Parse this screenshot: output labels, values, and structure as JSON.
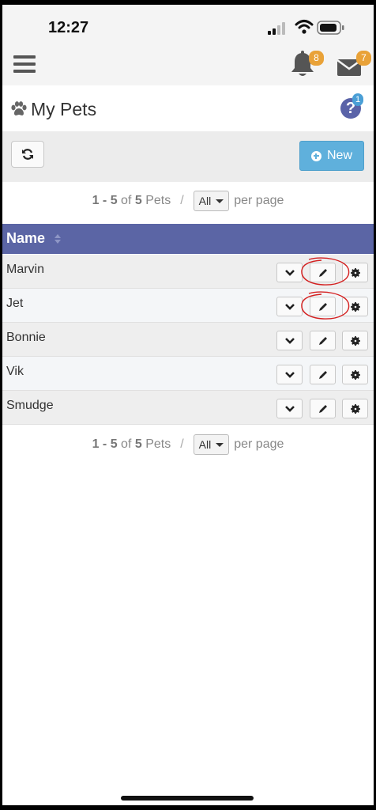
{
  "status_bar": {
    "time": "12:27"
  },
  "nav": {
    "notifications_count": "8",
    "messages_count": "7"
  },
  "title_bar": {
    "title": "My Pets",
    "help_badge": "1",
    "help_symbol": "?"
  },
  "toolbar": {
    "new_label": "New"
  },
  "pagination": {
    "range": "1 - 5",
    "of_text": "of",
    "total": "5",
    "unit": "Pets",
    "separator": "/",
    "per_page_value": "All",
    "per_page_text": "per page"
  },
  "table": {
    "column_name": "Name",
    "rows": [
      {
        "name": "Marvin"
      },
      {
        "name": "Jet"
      },
      {
        "name": "Bonnie"
      },
      {
        "name": "Vik"
      },
      {
        "name": "Smudge"
      }
    ]
  },
  "colors": {
    "header_bg": "#5b65a5",
    "new_button": "#5fb0dc",
    "badge": "#e9a238",
    "annotation": "#d42020"
  },
  "icons": [
    "hamburger-icon",
    "bell-icon",
    "envelope-icon",
    "paw-icon",
    "help-icon",
    "refresh-icon",
    "plus-circle-icon",
    "sort-icon",
    "chevron-down-icon",
    "pencil-icon",
    "gear-icon"
  ]
}
